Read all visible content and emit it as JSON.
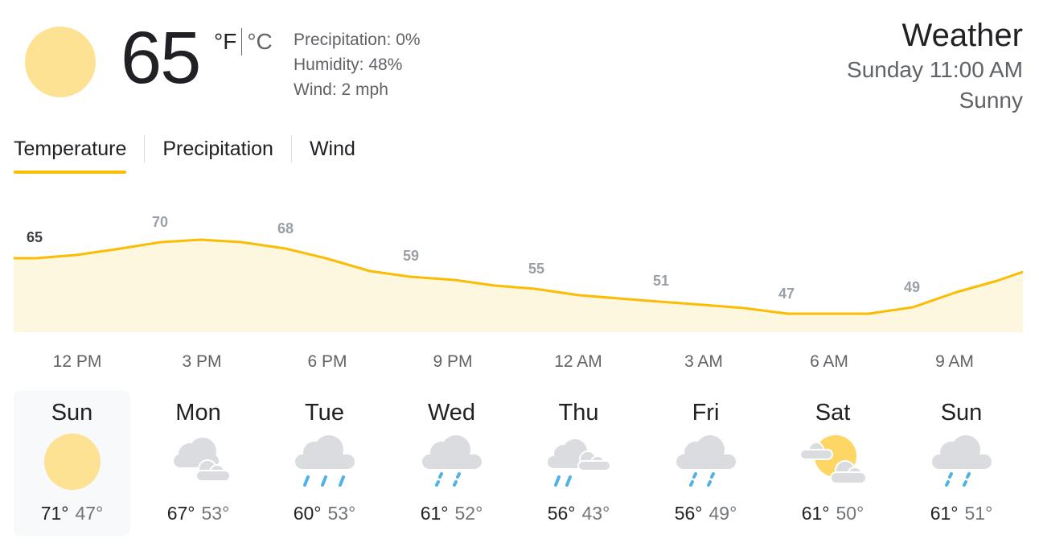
{
  "current": {
    "temperature": "65",
    "unit_f": "°F",
    "unit_c": "°C",
    "precipitation": "Precipitation: 0%",
    "humidity": "Humidity: 48%",
    "wind": "Wind: 2 mph",
    "icon": "sun-icon"
  },
  "header": {
    "title": "Weather",
    "datetime": "Sunday 11:00 AM",
    "condition": "Sunny"
  },
  "tabs": [
    {
      "label": "Temperature",
      "active": true
    },
    {
      "label": "Precipitation",
      "active": false
    },
    {
      "label": "Wind",
      "active": false
    }
  ],
  "colors": {
    "accent": "#fbbc04",
    "fill": "#fef7e0",
    "sun": "#fde293",
    "cloud": "#dadce0",
    "rain": "#4fb3e8"
  },
  "hourly": {
    "hours": [
      "12 PM",
      "3 PM",
      "6 PM",
      "9 PM",
      "12 AM",
      "3 AM",
      "6 AM",
      "9 AM"
    ],
    "labeled_temps": [
      "65",
      "70",
      "68",
      "59",
      "55",
      "51",
      "47",
      "49"
    ]
  },
  "days": [
    {
      "name": "Sun",
      "hi": "71°",
      "lo": "47°",
      "icon": "sun-icon",
      "selected": true
    },
    {
      "name": "Mon",
      "hi": "67°",
      "lo": "53°",
      "icon": "cloudy-icon",
      "selected": false
    },
    {
      "name": "Tue",
      "hi": "60°",
      "lo": "53°",
      "icon": "rain-icon",
      "selected": false
    },
    {
      "name": "Wed",
      "hi": "61°",
      "lo": "52°",
      "icon": "showers-icon",
      "selected": false
    },
    {
      "name": "Thu",
      "hi": "56°",
      "lo": "43°",
      "icon": "scattered-showers-icon",
      "selected": false
    },
    {
      "name": "Fri",
      "hi": "56°",
      "lo": "49°",
      "icon": "showers-icon",
      "selected": false
    },
    {
      "name": "Sat",
      "hi": "61°",
      "lo": "50°",
      "icon": "partly-cloudy-icon",
      "selected": false
    },
    {
      "name": "Sun",
      "hi": "61°",
      "lo": "51°",
      "icon": "showers-icon",
      "selected": false
    }
  ]
}
